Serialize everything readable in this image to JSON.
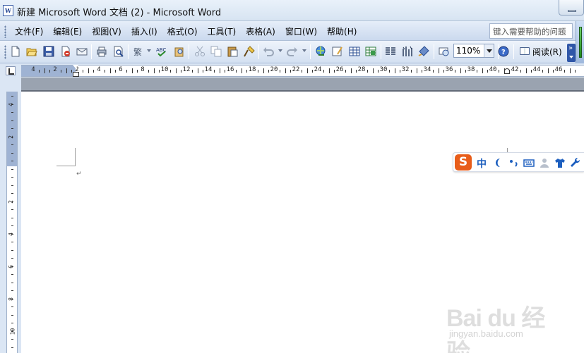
{
  "window": {
    "title": "新建 Microsoft Word 文档 (2) - Microsoft Word",
    "app_icon_text": "W"
  },
  "menubar": {
    "items": [
      {
        "label": "文件(F)"
      },
      {
        "label": "编辑(E)"
      },
      {
        "label": "视图(V)"
      },
      {
        "label": "插入(I)"
      },
      {
        "label": "格式(O)"
      },
      {
        "label": "工具(T)"
      },
      {
        "label": "表格(A)"
      },
      {
        "label": "窗口(W)"
      },
      {
        "label": "帮助(H)"
      }
    ],
    "help_placeholder": "键入需要帮助的问题"
  },
  "toolbar": {
    "zoom_value": "110%",
    "read_label": "阅读(R)",
    "icons": [
      "new-icon",
      "open-icon",
      "save-icon",
      "permission-icon",
      "print-icon",
      "print-preview-icon",
      "spelling-icon",
      "research-icon",
      "cut-icon",
      "copy-icon",
      "paste-icon",
      "format-painter-icon",
      "undo-icon",
      "redo-icon",
      "hyperlink-icon",
      "tables-borders-icon",
      "insert-table-icon",
      "insert-excel-icon",
      "columns-icon",
      "drawing-icon",
      "document-map-icon",
      "show-hide-icon",
      "help-icon"
    ]
  },
  "ruler": {
    "labels": [
      "4",
      "2",
      "2",
      "4",
      "6",
      "8",
      "10",
      "12",
      "14",
      "16",
      "18",
      "20",
      "22",
      "24",
      "26",
      "28",
      "30",
      "32",
      "34",
      "36",
      "38",
      "40",
      "42",
      "44",
      "46"
    ],
    "v_labels": [
      "4",
      "2",
      "2",
      "4",
      "6",
      "8",
      "10"
    ]
  },
  "document": {
    "paragraph_mark": "↵"
  },
  "ime": {
    "logo": "S",
    "mode": "中"
  },
  "watermark": {
    "brand": "Bai du 经验",
    "url": "jingyan.baidu.com"
  },
  "colors": {
    "toolbar_top": "#eef3fb",
    "toolbar_bottom": "#d3e0f1",
    "ruler_margin": "#9fb3d3",
    "page_band": "#9aa3b0",
    "ime_logo": "#e85d1a",
    "ime_text": "#1d5fbf"
  }
}
